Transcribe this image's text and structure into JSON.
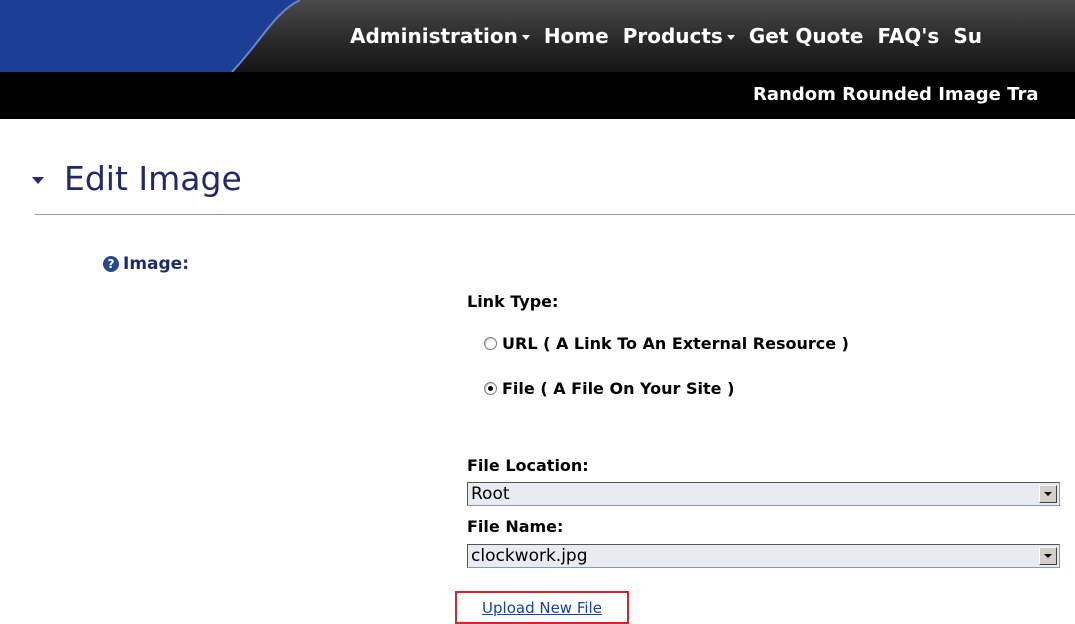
{
  "nav": {
    "items": [
      {
        "label": "Administration",
        "has_menu": true
      },
      {
        "label": "Home",
        "has_menu": false
      },
      {
        "label": "Products",
        "has_menu": true
      },
      {
        "label": "Get Quote",
        "has_menu": false
      },
      {
        "label": "FAQ's",
        "has_menu": false
      },
      {
        "label": "Su",
        "has_menu": false
      }
    ],
    "colors": {
      "bar": "#2a2a2a",
      "blue_tab": "#1c3f95",
      "text": "#ffffff"
    }
  },
  "breadcrumb": "Random Rounded Image Tra",
  "section": {
    "title": "Edit Image",
    "title_color": "#1f2a6b"
  },
  "field": {
    "label": "Image:",
    "help_icon": "question-circle-icon"
  },
  "form": {
    "link_type_label": "Link Type:",
    "options": [
      {
        "label": "URL ( A Link To An External Resource )",
        "selected": false
      },
      {
        "label": "File ( A File On Your Site )",
        "selected": true
      }
    ],
    "file_location_label": "File Location:",
    "file_location_value": "Root",
    "file_name_label": "File Name:",
    "file_name_value": "clockwork.jpg",
    "upload_link": "Upload New File",
    "highlight_color": "#e01f26"
  }
}
